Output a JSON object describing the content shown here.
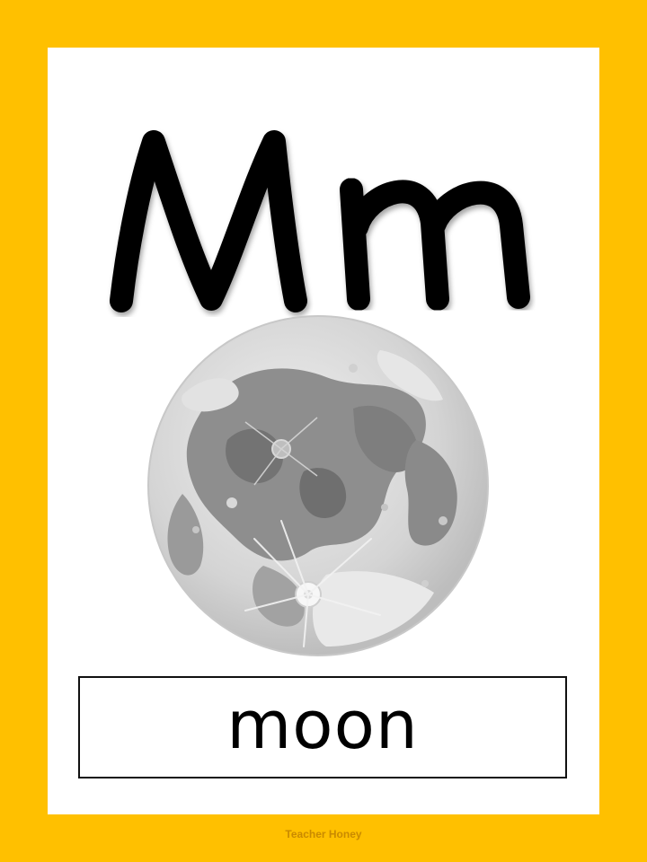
{
  "card": {
    "letter_upper": "M",
    "letter_lower": "m",
    "picture_icon": "moon-icon",
    "word": "moon"
  },
  "footer": {
    "credit": "Teacher Honey"
  },
  "colors": {
    "frame": "#FFC000",
    "card": "#FFFFFF",
    "letters": "#000000",
    "moon_light": "#DCDCDC",
    "moon_dark": "#8C8C8C"
  }
}
